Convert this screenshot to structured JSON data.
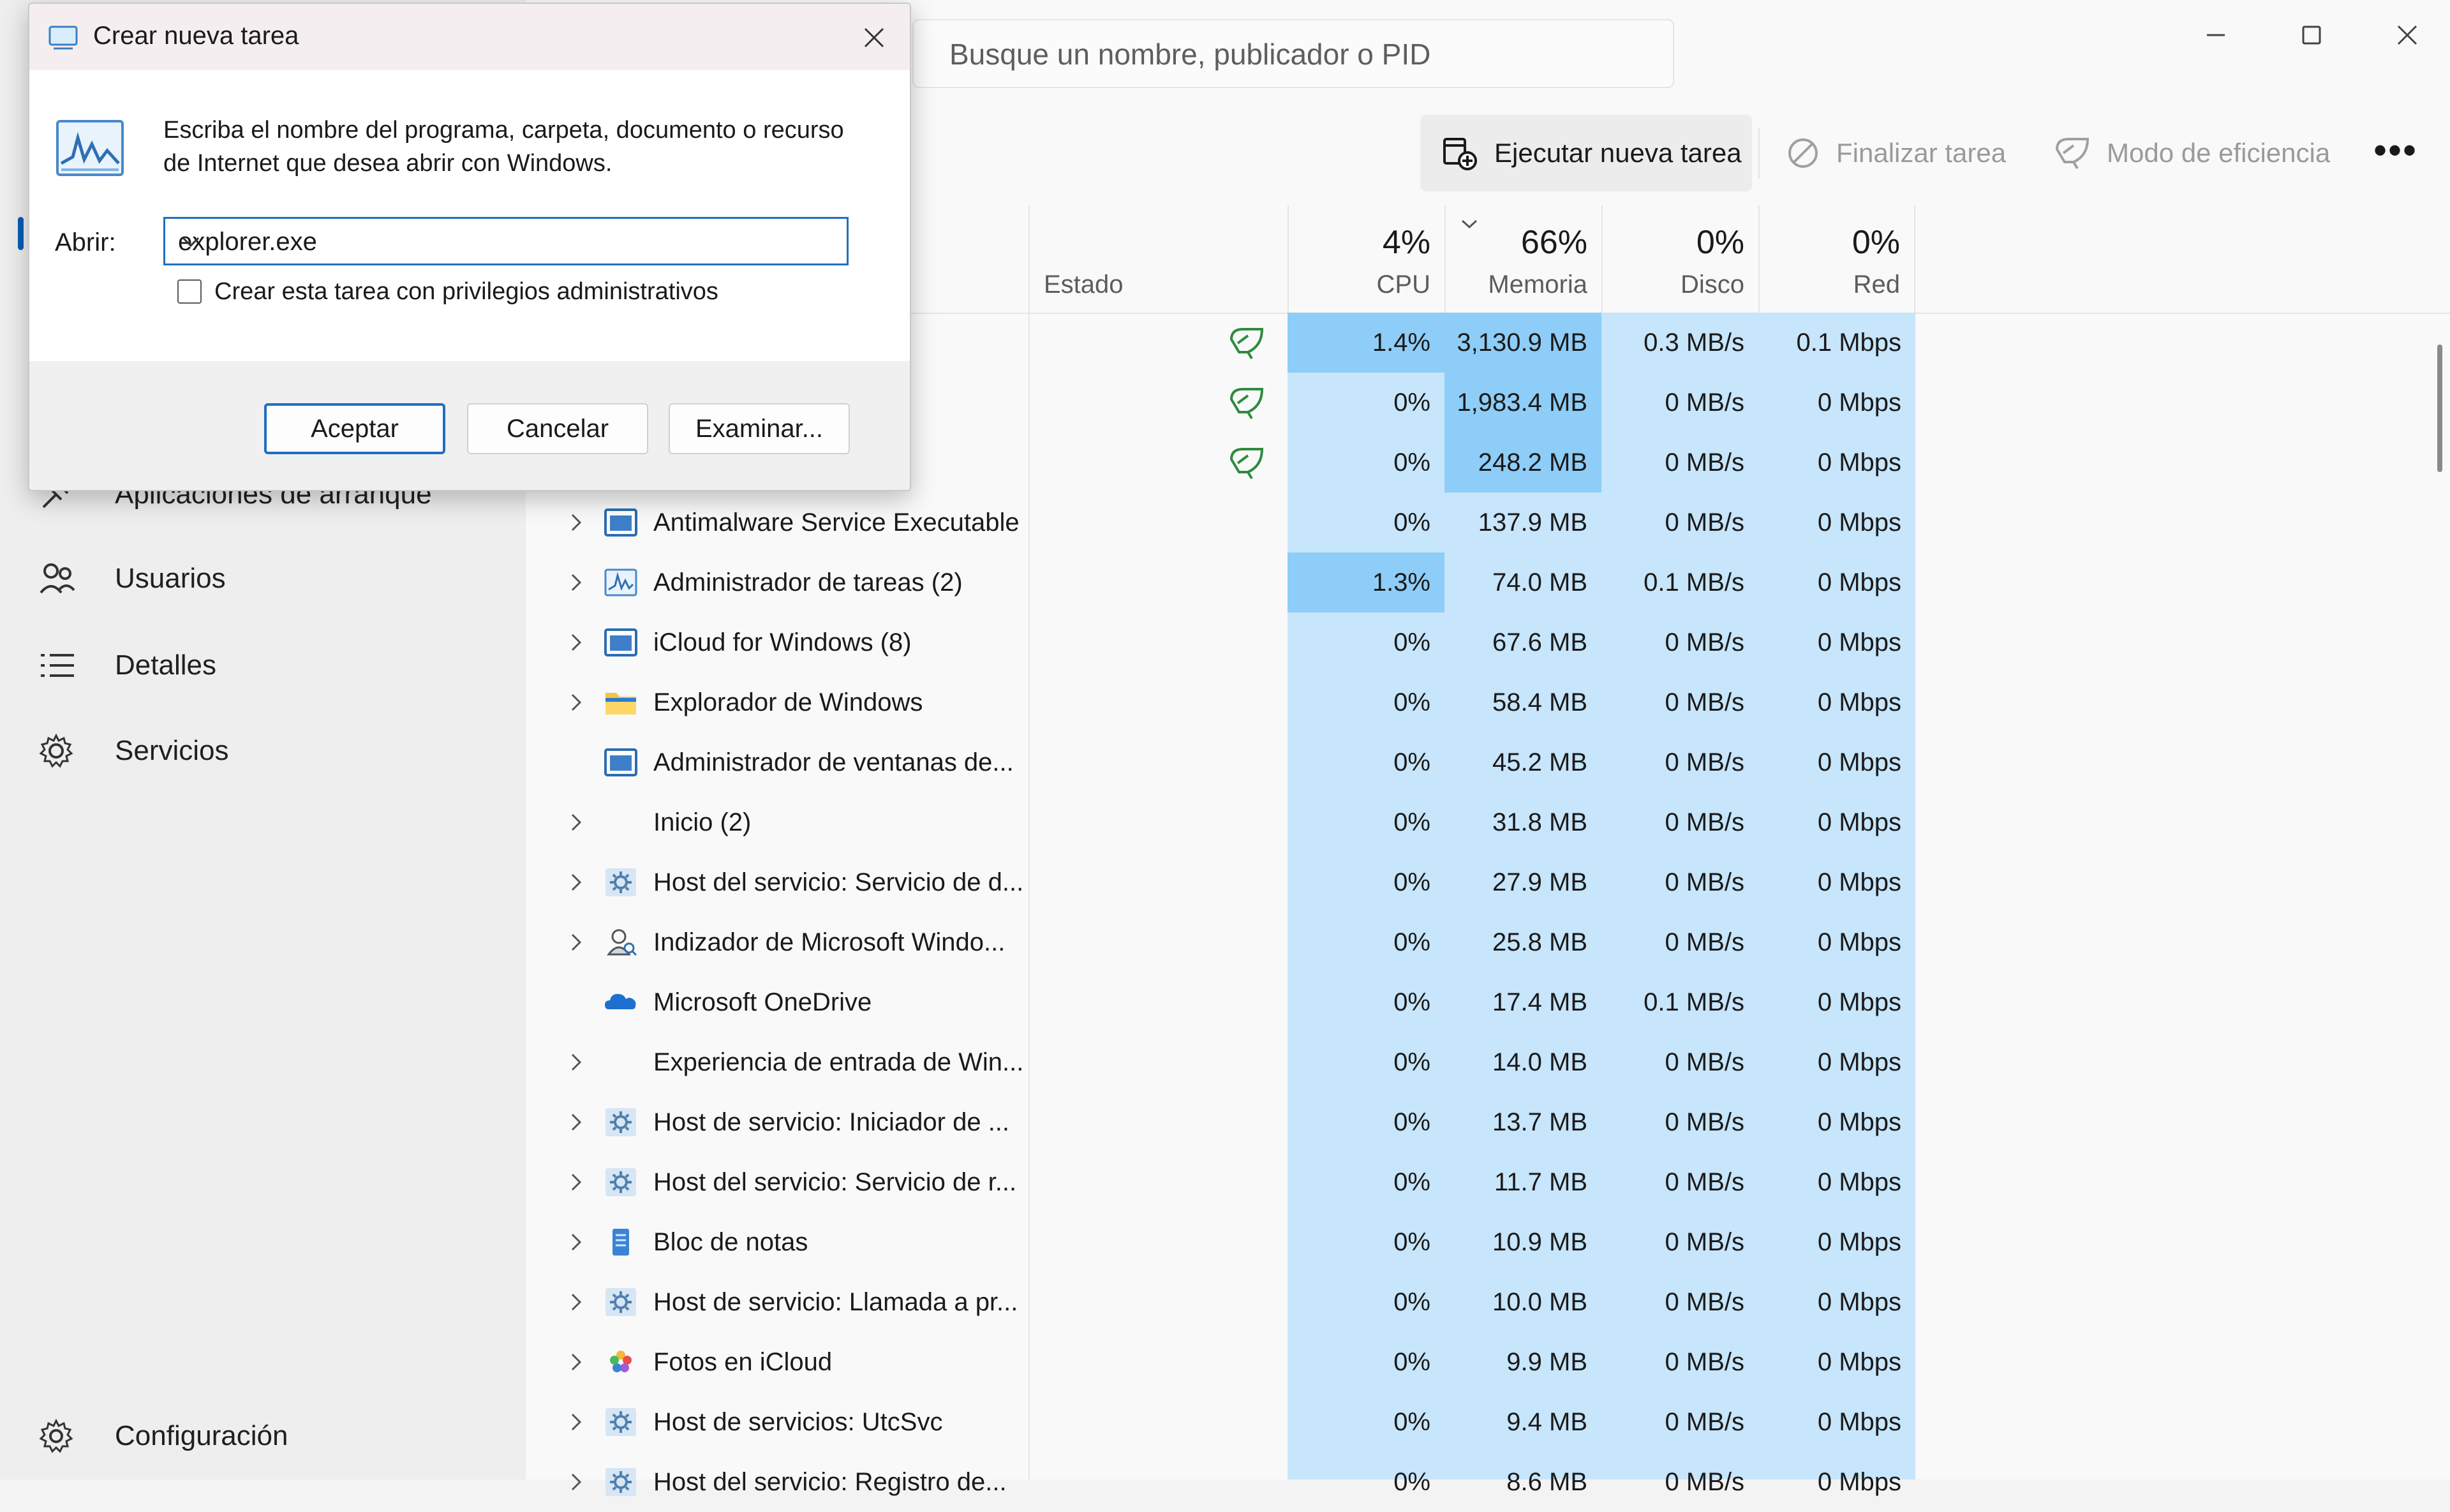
{
  "window": {
    "search_placeholder": "Busque un nombre, publicador o PID",
    "controls": [
      "minimize",
      "maximize",
      "close"
    ]
  },
  "sidebar": {
    "items": [
      {
        "label": "Aplicaciones de arranque",
        "icon": "startup-apps-icon"
      },
      {
        "label": "Usuarios",
        "icon": "users-icon"
      },
      {
        "label": "Detalles",
        "icon": "details-list-icon"
      },
      {
        "label": "Servicios",
        "icon": "services-gear-icon"
      }
    ],
    "settings_label": "Configuración"
  },
  "commandbar": {
    "run_task": "Ejecutar nueva tarea",
    "end_task": "Finalizar tarea",
    "efficiency_mode": "Modo de eficiencia",
    "more": "•••"
  },
  "table": {
    "columns": {
      "status": "Estado",
      "cpu": {
        "pct": "4%",
        "label": "CPU"
      },
      "memory": {
        "pct": "66%",
        "label": "Memoria"
      },
      "disk": {
        "pct": "0%",
        "label": "Disco"
      },
      "network": {
        "pct": "0%",
        "label": "Red"
      }
    },
    "rows": [
      {
        "name": "",
        "cpu": "1.4%",
        "mem": "3,130.9 MB",
        "disk": "0.3 MB/s",
        "net": "0.1 Mbps",
        "eco": true,
        "expand": false,
        "icon": "none"
      },
      {
        "name": "",
        "cpu": "0%",
        "mem": "1,983.4 MB",
        "disk": "0 MB/s",
        "net": "0 Mbps",
        "eco": true,
        "expand": false,
        "icon": "none"
      },
      {
        "name": "",
        "cpu": "0%",
        "mem": "248.2 MB",
        "disk": "0 MB/s",
        "net": "0 Mbps",
        "eco": true,
        "expand": false,
        "icon": "none"
      },
      {
        "name": "Antimalware Service Executable",
        "cpu": "0%",
        "mem": "137.9 MB",
        "disk": "0 MB/s",
        "net": "0 Mbps",
        "expand": true,
        "icon": "window"
      },
      {
        "name": "Administrador de tareas (2)",
        "cpu": "1.3%",
        "mem": "74.0 MB",
        "disk": "0.1 MB/s",
        "net": "0 Mbps",
        "expand": true,
        "icon": "taskmgr"
      },
      {
        "name": "iCloud for Windows (8)",
        "cpu": "0%",
        "mem": "67.6 MB",
        "disk": "0 MB/s",
        "net": "0 Mbps",
        "expand": true,
        "icon": "window"
      },
      {
        "name": "Explorador de Windows",
        "cpu": "0%",
        "mem": "58.4 MB",
        "disk": "0 MB/s",
        "net": "0 Mbps",
        "expand": true,
        "icon": "folder"
      },
      {
        "name": "Administrador de ventanas de...",
        "cpu": "0%",
        "mem": "45.2 MB",
        "disk": "0 MB/s",
        "net": "0 Mbps",
        "expand": false,
        "icon": "window"
      },
      {
        "name": "Inicio (2)",
        "cpu": "0%",
        "mem": "31.8 MB",
        "disk": "0 MB/s",
        "net": "0 Mbps",
        "expand": true,
        "icon": "none"
      },
      {
        "name": "Host del servicio: Servicio de d...",
        "cpu": "0%",
        "mem": "27.9 MB",
        "disk": "0 MB/s",
        "net": "0 Mbps",
        "expand": true,
        "icon": "gear"
      },
      {
        "name": "Indizador de Microsoft Windo...",
        "cpu": "0%",
        "mem": "25.8 MB",
        "disk": "0 MB/s",
        "net": "0 Mbps",
        "expand": true,
        "icon": "indexer"
      },
      {
        "name": "Microsoft OneDrive",
        "cpu": "0%",
        "mem": "17.4 MB",
        "disk": "0.1 MB/s",
        "net": "0 Mbps",
        "expand": false,
        "icon": "cloud"
      },
      {
        "name": "Experiencia de entrada de Win...",
        "cpu": "0%",
        "mem": "14.0 MB",
        "disk": "0 MB/s",
        "net": "0 Mbps",
        "expand": true,
        "icon": "none"
      },
      {
        "name": "Host de servicio: Iniciador de ...",
        "cpu": "0%",
        "mem": "13.7 MB",
        "disk": "0 MB/s",
        "net": "0 Mbps",
        "expand": true,
        "icon": "gear"
      },
      {
        "name": "Host del servicio: Servicio de r...",
        "cpu": "0%",
        "mem": "11.7 MB",
        "disk": "0 MB/s",
        "net": "0 Mbps",
        "expand": true,
        "icon": "gear"
      },
      {
        "name": "Bloc de notas",
        "cpu": "0%",
        "mem": "10.9 MB",
        "disk": "0 MB/s",
        "net": "0 Mbps",
        "expand": true,
        "icon": "notepad"
      },
      {
        "name": "Host de servicio: Llamada a pr...",
        "cpu": "0%",
        "mem": "10.0 MB",
        "disk": "0 MB/s",
        "net": "0 Mbps",
        "expand": true,
        "icon": "gear"
      },
      {
        "name": "Fotos en iCloud",
        "cpu": "0%",
        "mem": "9.9 MB",
        "disk": "0 MB/s",
        "net": "0 Mbps",
        "expand": true,
        "icon": "photos"
      },
      {
        "name": "Host de servicios: UtcSvc",
        "cpu": "0%",
        "mem": "9.4 MB",
        "disk": "0 MB/s",
        "net": "0 Mbps",
        "expand": true,
        "icon": "gear"
      },
      {
        "name": "Host del servicio: Registro de...",
        "cpu": "0%",
        "mem": "8.6 MB",
        "disk": "0 MB/s",
        "net": "0 Mbps",
        "expand": true,
        "icon": "gear"
      }
    ]
  },
  "dialog": {
    "title": "Crear nueva tarea",
    "description": "Escriba el nombre del programa, carpeta, documento o recurso de Internet que desea abrir con Windows.",
    "open_label": "Abrir:",
    "input_value": "explorer.exe",
    "admin_checkbox_label": "Crear esta tarea con privilegios administrativos",
    "admin_checked": false,
    "ok": "Aceptar",
    "cancel": "Cancelar",
    "browse": "Examinar..."
  },
  "colors": {
    "accent": "#005fb8",
    "heat_light": "#c7e5fb",
    "heat_medium": "#8ecdf7",
    "eco_green": "#2e8b3d"
  }
}
